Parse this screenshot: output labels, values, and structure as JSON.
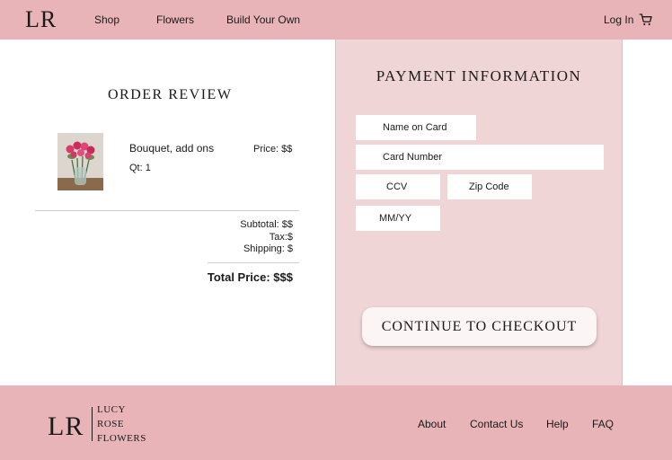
{
  "header": {
    "logo": "LR",
    "nav": {
      "shop": "Shop",
      "flowers": "Flowers",
      "build": "Build Your Own"
    },
    "login": "Log In",
    "cart_icon": "shopping-cart-icon"
  },
  "order": {
    "title": "Order Review",
    "item": {
      "name": "Bouquet, add ons",
      "qty": "Qt: 1",
      "price": "Price: $$"
    },
    "subtotal": "Subtotal: $$",
    "tax": "Tax:$",
    "shipping": "Shipping: $",
    "total": "Total Price: $$$"
  },
  "payment": {
    "title": "Payment Information",
    "name_placeholder": "Name on Card",
    "card_placeholder": "Card Number",
    "ccv_placeholder": "CCV",
    "zip_placeholder": "Zip Code",
    "expiry_placeholder": "MM/YY",
    "checkout_label": "Continue to Checkout"
  },
  "footer": {
    "logo": "LR",
    "words": [
      "Lucy",
      "Rose",
      "Flowers"
    ],
    "links": {
      "about": "About",
      "contact": "Contact Us",
      "help": "Help",
      "faq": "FAQ"
    }
  },
  "colors": {
    "header_bg": "#e8b4b8",
    "panel_bg": "#f0d5d6",
    "button_bg": "#fbf5f5"
  }
}
